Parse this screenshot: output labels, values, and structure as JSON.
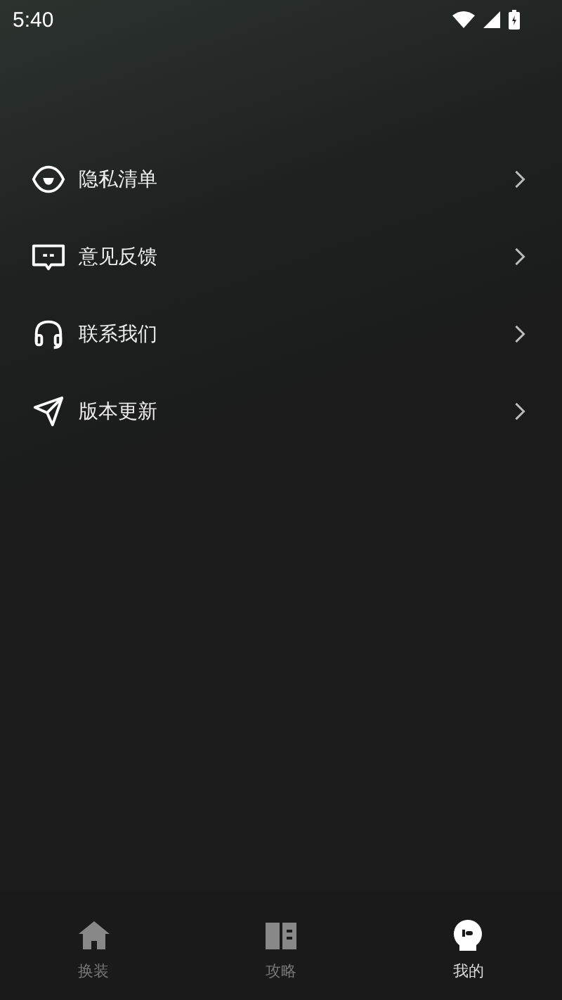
{
  "status_bar": {
    "time": "5:40"
  },
  "menu": [
    {
      "kind": "privacy",
      "label": "隐私清单"
    },
    {
      "kind": "feedback",
      "label": "意见反馈"
    },
    {
      "kind": "contact",
      "label": "联系我们"
    },
    {
      "kind": "update",
      "label": "版本更新"
    }
  ],
  "tabs": [
    {
      "kind": "home",
      "label": "换装",
      "selected": false
    },
    {
      "kind": "guide",
      "label": "攻略",
      "selected": false
    },
    {
      "kind": "me",
      "label": "我的",
      "selected": true
    }
  ]
}
